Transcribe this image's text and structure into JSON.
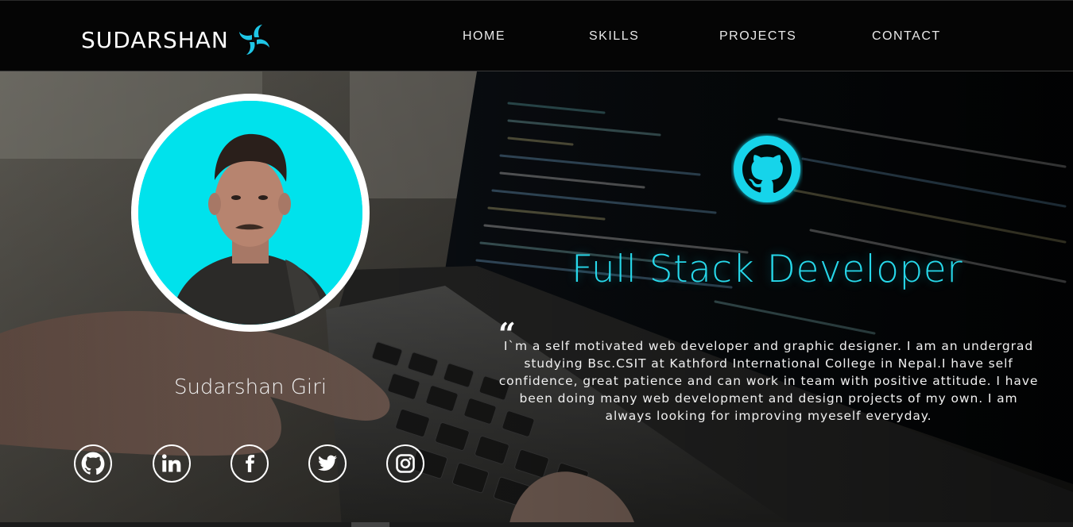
{
  "header": {
    "brand_name": "SUDARSHAN",
    "brand_icon": "pinwheel-logo-icon",
    "nav": [
      {
        "label": "HOME"
      },
      {
        "label": "SKILLS"
      },
      {
        "label": "PROJECTS"
      },
      {
        "label": "CONTACT"
      }
    ]
  },
  "hero": {
    "name": "Sudarshan Giri",
    "role": "Full Stack Developer",
    "quote_mark": "“",
    "bio": "I`m a self motivated web developer and graphic designer. I am an undergrad studying Bsc.CSIT at Kathford International College in Nepal.I have self confidence, great patience and can work in team with positive attitude. I have been doing many web development and design projects of my own. I am always looking for improving myeself everyday.",
    "socials": [
      {
        "icon": "github-icon"
      },
      {
        "icon": "linkedin-icon"
      },
      {
        "icon": "facebook-icon"
      },
      {
        "icon": "twitter-icon"
      },
      {
        "icon": "instagram-icon"
      }
    ]
  },
  "colors": {
    "accent": "#27d8ea",
    "avatar_bg": "#00e2ec",
    "nav_bg": "#050505"
  }
}
